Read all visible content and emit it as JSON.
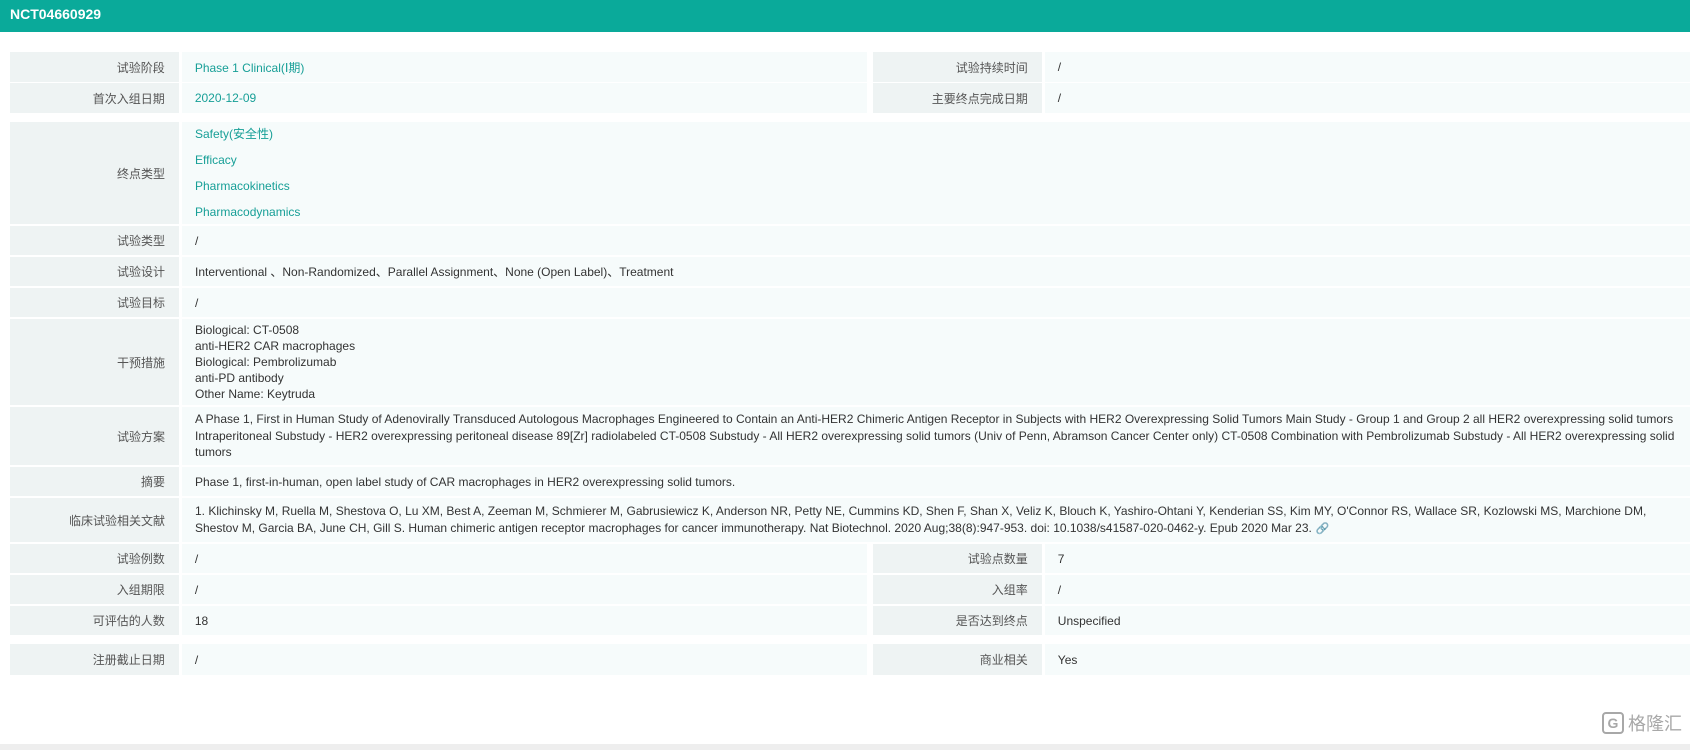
{
  "header": {
    "title": "NCT04660929"
  },
  "rows": {
    "phase": {
      "label": "试验阶段",
      "value": "Phase 1 Clinical(Ⅰ期)"
    },
    "duration": {
      "label": "试验持续时间",
      "value": "/"
    },
    "first_enroll": {
      "label": "首次入组日期",
      "value": "2020-12-09"
    },
    "primary_completion": {
      "label": "主要终点完成日期",
      "value": "/"
    },
    "endpoint_types": {
      "label": "终点类型",
      "values": [
        "Safety(安全性)",
        "Efficacy",
        "Pharmacokinetics",
        "Pharmacodynamics"
      ]
    },
    "trial_type": {
      "label": "试验类型",
      "value": "/"
    },
    "design": {
      "label": "试验设计",
      "value": "Interventional 、Non-Randomized、Parallel Assignment、None (Open Label)、Treatment"
    },
    "objective": {
      "label": "试验目标",
      "value": "/"
    },
    "intervention": {
      "label": "干预措施",
      "lines": [
        "Biological: CT-0508",
        "anti-HER2 CAR macrophages",
        "Biological: Pembrolizumab",
        "anti-PD antibody",
        "Other Name: Keytruda"
      ]
    },
    "protocol": {
      "label": "试验方案",
      "value": "A Phase 1, First in Human Study of Adenovirally Transduced Autologous Macrophages Engineered to Contain an Anti-HER2 Chimeric Antigen Receptor in Subjects with HER2 Overexpressing Solid Tumors Main Study - Group 1 and Group 2 all HER2 overexpressing solid tumors Intraperitoneal Substudy - HER2 overexpressing peritoneal disease 89[Zr] radiolabeled CT-0508 Substudy - All HER2 overexpressing solid tumors (Univ of Penn, Abramson Cancer Center only) CT-0508 Combination with Pembrolizumab Substudy - All HER2 overexpressing solid tumors"
    },
    "abstract": {
      "label": "摘要",
      "value": "Phase 1, first-in-human, open label study of CAR macrophages in HER2 overexpressing solid tumors."
    },
    "literature": {
      "label": "临床试验相关文献",
      "value": "1. Klichinsky M, Ruella M, Shestova O, Lu XM, Best A, Zeeman M, Schmierer M, Gabrusiewicz K, Anderson NR, Petty NE, Cummins KD, Shen F, Shan X, Veliz K, Blouch K, Yashiro-Ohtani Y, Kenderian SS, Kim MY, O'Connor RS, Wallace SR, Kozlowski MS, Marchione DM, Shestov M, Garcia BA, June CH, Gill S. Human chimeric antigen receptor macrophages for cancer immunotherapy. Nat Biotechnol. 2020 Aug;38(8):947-953. doi: 10.1038/s41587-020-0462-y. Epub 2020 Mar 23."
    },
    "cases": {
      "label": "试验例数",
      "value": "/"
    },
    "sites": {
      "label": "试验点数量",
      "value": "7"
    },
    "enroll_period": {
      "label": "入组期限",
      "value": "/"
    },
    "enroll_rate": {
      "label": "入组率",
      "value": "/"
    },
    "evaluable": {
      "label": "可评估的人数",
      "value": "18"
    },
    "endpoint_met": {
      "label": "是否达到终点",
      "value": "Unspecified"
    },
    "reg_deadline": {
      "label": "注册截止日期",
      "value": "/"
    },
    "commercial": {
      "label": "商业相关",
      "value": "Yes"
    }
  },
  "watermark": {
    "text": "格隆汇",
    "badge": "G"
  }
}
